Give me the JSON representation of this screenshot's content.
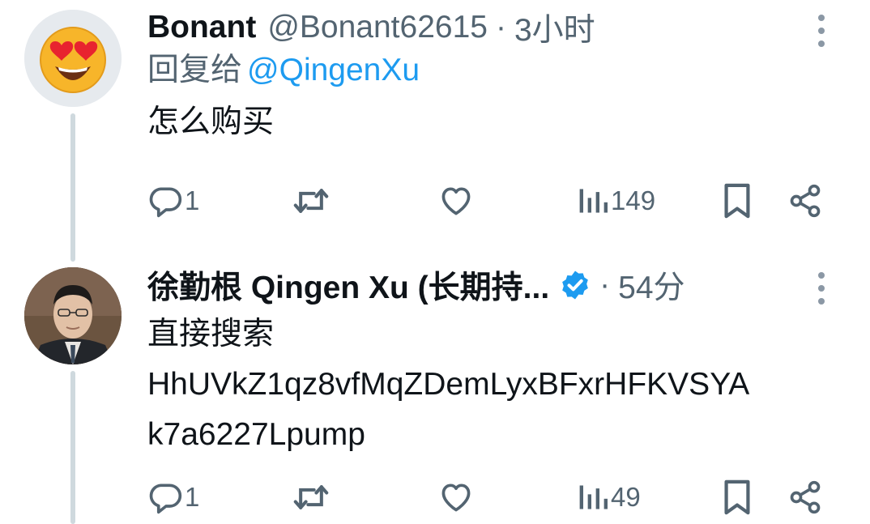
{
  "tweets": [
    {
      "display_name": "Bonant",
      "handle": "@Bonant62615",
      "separator": "·",
      "time": "3小时",
      "reply_prefix": "回复给",
      "reply_mention": "@QingenXu",
      "body_lines": [
        "怎么购买"
      ],
      "avatar_icon": "heart-eyes-emoji-icon",
      "stats": {
        "replies": "1",
        "views": "149"
      }
    },
    {
      "display_name": "徐勤根 Qingen Xu (长期持...",
      "verified": true,
      "separator": "·",
      "time": "54分",
      "avatar_icon": "profile-photo",
      "body_lines": [
        "直接搜索",
        "HhUVkZ1qz8vfMqZDemLyxBFxrHFKVSYA",
        "k7a6227Lpump"
      ],
      "stats": {
        "replies": "1",
        "views": "49"
      }
    }
  ],
  "colors": {
    "accent": "#1d9bf0",
    "secondary_text": "#536471",
    "thread_line": "#cfd9de",
    "primary_text": "#0f1419"
  }
}
